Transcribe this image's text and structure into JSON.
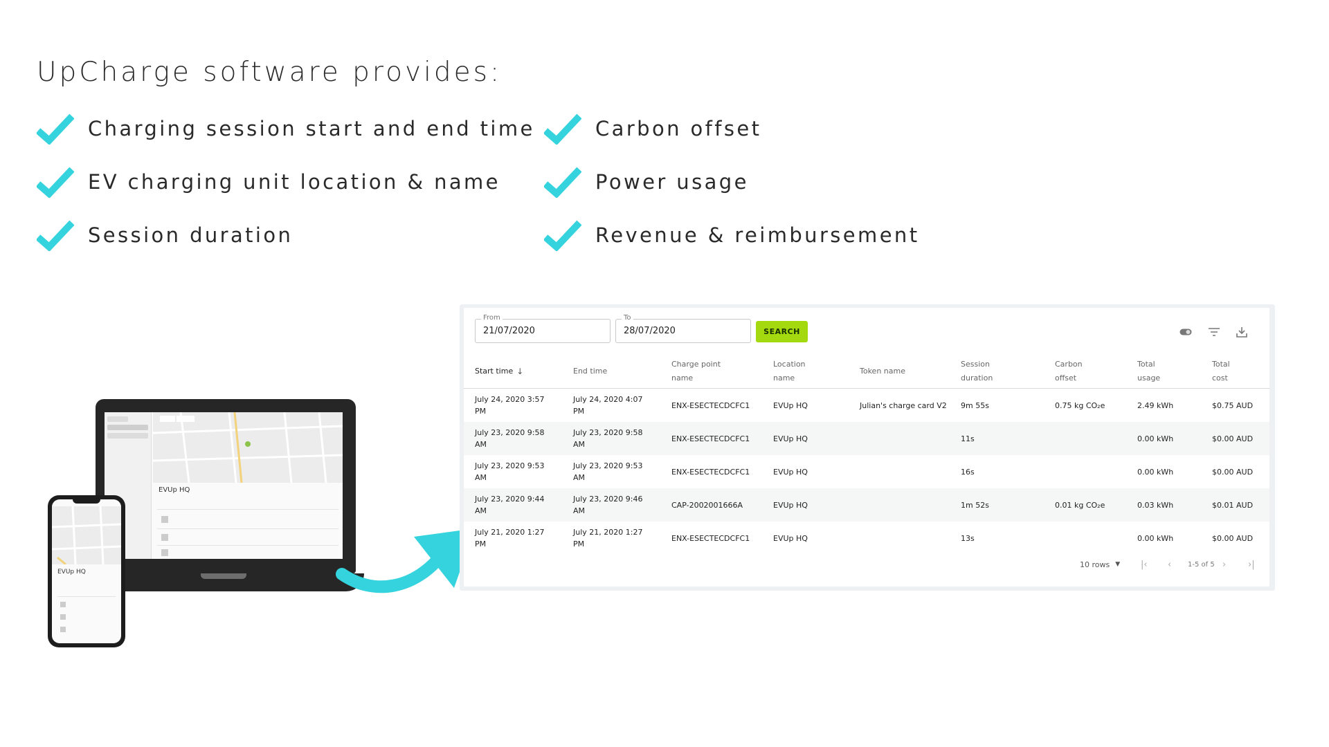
{
  "headline": "UpCharge software provides:",
  "colors": {
    "check": "#35d3dd",
    "accent": "#a5d90f",
    "arrow": "#35d3dd"
  },
  "features": [
    "Charging session start and end time",
    "EV charging unit location & name",
    "Session duration",
    "Carbon offset",
    "Power usage",
    "Revenue & reimbursement"
  ],
  "devices": {
    "laptop_title": "EVUp HQ",
    "phone_title": "EVUp HQ"
  },
  "filters": {
    "from_label": "From",
    "from_value": "21/07/2020",
    "to_label": "To",
    "to_value": "28/07/2020",
    "search_label": "SEARCH"
  },
  "toolbar_icons": [
    "toggle-icon",
    "filter-icon",
    "download-icon"
  ],
  "table": {
    "columns": [
      {
        "line1": "Start time",
        "line2": ""
      },
      {
        "line1": "End time",
        "line2": ""
      },
      {
        "line1": "Charge point",
        "line2": "name"
      },
      {
        "line1": "Location",
        "line2": "name"
      },
      {
        "line1": "Token name",
        "line2": ""
      },
      {
        "line1": "Session",
        "line2": "duration"
      },
      {
        "line1": "Carbon",
        "line2": "offset"
      },
      {
        "line1": "Total",
        "line2": "usage"
      },
      {
        "line1": "Total",
        "line2": "cost"
      }
    ],
    "rows": [
      [
        "July 24, 2020 3:57 PM",
        "July 24, 2020 4:07 PM",
        "ENX-ESECTECDCFC1",
        "EVUp HQ",
        "Julian's charge card V2",
        "9m 55s",
        "0.75 kg CO₂e",
        "2.49 kWh",
        "$0.75 AUD"
      ],
      [
        "July 23, 2020 9:58 AM",
        "July 23, 2020 9:58 AM",
        "ENX-ESECTECDCFC1",
        "EVUp HQ",
        "",
        "11s",
        "",
        "0.00 kWh",
        "$0.00 AUD"
      ],
      [
        "July 23, 2020 9:53 AM",
        "July 23, 2020 9:53 AM",
        "ENX-ESECTECDCFC1",
        "EVUp HQ",
        "",
        "16s",
        "",
        "0.00 kWh",
        "$0.00 AUD"
      ],
      [
        "July 23, 2020 9:44 AM",
        "July 23, 2020 9:46 AM",
        "CAP-2002001666A",
        "EVUp HQ",
        "",
        "1m 52s",
        "0.01 kg CO₂e",
        "0.03 kWh",
        "$0.01 AUD"
      ],
      [
        "July 21, 2020 1:27 PM",
        "July 21, 2020 1:27 PM",
        "ENX-ESECTECDCFC1",
        "EVUp HQ",
        "",
        "13s",
        "",
        "0.00 kWh",
        "$0.00 AUD"
      ]
    ]
  },
  "pagination": {
    "rows_label": "10 rows",
    "range": "1-5 of 5"
  }
}
